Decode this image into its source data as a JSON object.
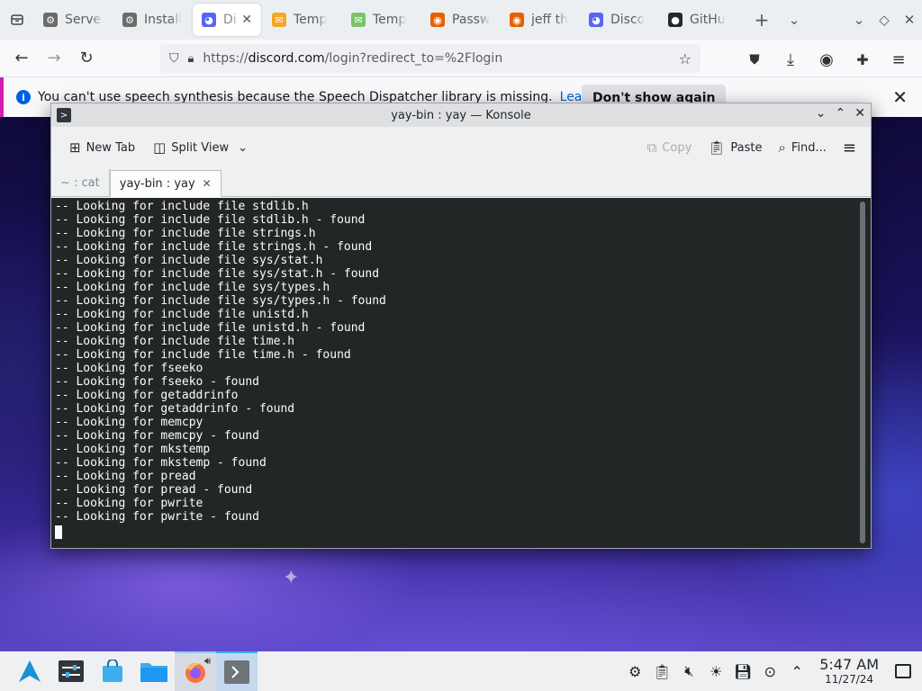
{
  "browser": {
    "tabs": [
      {
        "label": "Server",
        "icon": "gear-icon",
        "color": "#6b6b6b",
        "active": false
      },
      {
        "label": "Install",
        "icon": "gear-icon",
        "color": "#6b6b6b",
        "active": false
      },
      {
        "label": "Disc",
        "icon": "discord-icon",
        "color": "#5865f2",
        "active": true
      },
      {
        "label": "Temp",
        "icon": "mail-icon",
        "color": "#f5a623",
        "active": false
      },
      {
        "label": "Temp",
        "icon": "mail-icon",
        "color": "#7cc36b",
        "active": false
      },
      {
        "label": "Passw",
        "icon": "firefox-icon",
        "color": "#e66000",
        "active": false
      },
      {
        "label": "jeff th",
        "icon": "firefox-icon",
        "color": "#e66000",
        "active": false
      },
      {
        "label": "Disco",
        "icon": "discord-icon",
        "color": "#5865f2",
        "active": false
      },
      {
        "label": "GitHu",
        "icon": "github-icon",
        "color": "#24292f",
        "active": false
      }
    ],
    "url_prefix": "https://",
    "url_domain": "discord.com",
    "url_path": "/login?redirect_to=%2Flogin",
    "notification": {
      "message": "You can't use speech synthesis because the Speech Dispatcher library is missing.",
      "learn_more": "Learn more",
      "dont_show": "Don't show again"
    }
  },
  "konsole": {
    "title": "yay-bin : yay — Konsole",
    "toolbar": {
      "new_tab": "New Tab",
      "split_view": "Split View",
      "copy": "Copy",
      "paste": "Paste",
      "find": "Find..."
    },
    "tabs": [
      {
        "label": "~ : cat",
        "active": false
      },
      {
        "label": "yay-bin : yay",
        "active": true
      }
    ],
    "output": [
      "-- Looking for include file stdlib.h",
      "-- Looking for include file stdlib.h - found",
      "-- Looking for include file strings.h",
      "-- Looking for include file strings.h - found",
      "-- Looking for include file sys/stat.h",
      "-- Looking for include file sys/stat.h - found",
      "-- Looking for include file sys/types.h",
      "-- Looking for include file sys/types.h - found",
      "-- Looking for include file unistd.h",
      "-- Looking for include file unistd.h - found",
      "-- Looking for include file time.h",
      "-- Looking for include file time.h - found",
      "-- Looking for fseeko",
      "-- Looking for fseeko - found",
      "-- Looking for getaddrinfo",
      "-- Looking for getaddrinfo - found",
      "-- Looking for memcpy",
      "-- Looking for memcpy - found",
      "-- Looking for mkstemp",
      "-- Looking for mkstemp - found",
      "-- Looking for pread",
      "-- Looking for pread - found",
      "-- Looking for pwrite",
      "-- Looking for pwrite - found"
    ]
  },
  "taskbar": {
    "time": "5:47 AM",
    "date": "11/27/24"
  },
  "colors": {
    "accent": "#3daee9",
    "terminal_bg": "#232627",
    "notification_accent": "#d11fb5"
  }
}
